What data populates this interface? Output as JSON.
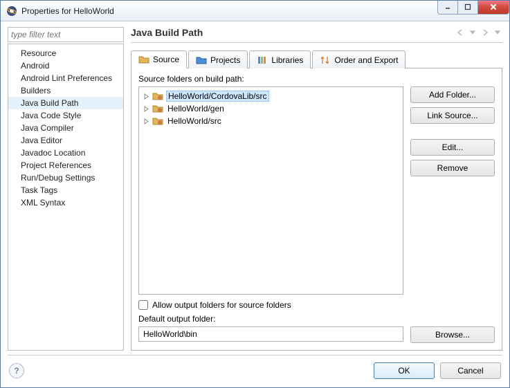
{
  "window": {
    "title": "Properties for HelloWorld"
  },
  "nav": {
    "filter_placeholder": "type filter text",
    "items": [
      "Resource",
      "Android",
      "Android Lint Preferences",
      "Builders",
      "Java Build Path",
      "Java Code Style",
      "Java Compiler",
      "Java Editor",
      "Javadoc Location",
      "Project References",
      "Run/Debug Settings",
      "Task Tags",
      "XML Syntax"
    ],
    "selected": "Java Build Path"
  },
  "main": {
    "title": "Java Build Path",
    "tabs": [
      {
        "label": "Source"
      },
      {
        "label": "Projects"
      },
      {
        "label": "Libraries"
      },
      {
        "label": "Order and Export"
      }
    ],
    "active_tab": "Source",
    "source": {
      "label": "Source folders on build path:",
      "folders": [
        "HelloWorld/CordovaLib/src",
        "HelloWorld/gen",
        "HelloWorld/src"
      ],
      "selected": "HelloWorld/CordovaLib/src",
      "buttons": {
        "add_folder": "Add Folder...",
        "link_source": "Link Source...",
        "edit": "Edit...",
        "remove": "Remove"
      },
      "allow_output": "Allow output folders for source folders",
      "default_output_label": "Default output folder:",
      "default_output_value": "HelloWorld\\bin",
      "browse": "Browse..."
    }
  },
  "footer": {
    "ok": "OK",
    "cancel": "Cancel"
  }
}
